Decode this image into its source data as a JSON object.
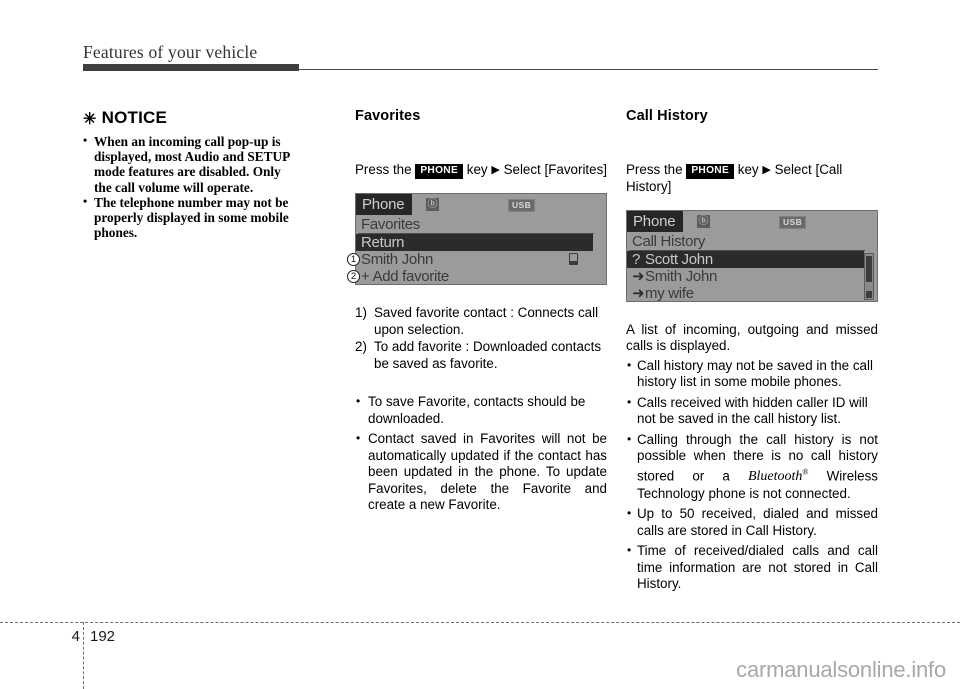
{
  "header": {
    "title": "Features of your vehicle"
  },
  "notice": {
    "title": "NOTICE",
    "asterisk": "✳",
    "items": [
      "When an incoming call pop-up is displayed, most Audio and SETUP mode features are disabled. Only the call volume will operate.",
      "The telephone number may not be properly displayed in some mobile phones."
    ],
    "item_lines": [
      [
        "When an incoming call pop-up is",
        "displayed, most Audio and SETUP",
        "mode features are disabled. Only",
        "the call volume will operate."
      ],
      [
        "The telephone number may not be",
        "properly displayed in some mobile",
        "phones."
      ]
    ]
  },
  "favorites": {
    "heading": "Favorites",
    "press": {
      "before_key": "Press the",
      "key_label": "PHONE",
      "after_key": "key",
      "arrow": "▶",
      "action": "Select [Favorites]"
    },
    "screen": {
      "statusbar": {
        "tab": "Phone",
        "bluetooth_icon": "ⓑ",
        "usb_label": "USB"
      },
      "title": "Favorites",
      "rows": [
        {
          "icon": "",
          "label": "Return",
          "selected": true,
          "handset": false
        },
        {
          "icon": "",
          "label": "Smith John",
          "selected": false,
          "handset": true
        },
        {
          "icon": "",
          "label": "+ Add favorite",
          "selected": false,
          "handset": false
        }
      ],
      "callouts": [
        "1",
        "2"
      ]
    },
    "numbered": [
      {
        "marker": "1)",
        "text": "Saved favorite contact : Connects call upon selection."
      },
      {
        "marker": "2)",
        "text": "To add favorite : Downloaded contacts be saved as favorite."
      }
    ],
    "bullets": [
      "To save Favorite, contacts should be downloaded.",
      "Contact saved in Favorites will not be automatically updated if the contact has been updated in the phone. To update Favorites, delete the Favorite and create a new Favorite."
    ]
  },
  "call_history": {
    "heading": "Call History",
    "press": {
      "before_key": "Press the",
      "key_label": "PHONE",
      "after_key": "key",
      "arrow": "▶",
      "action": "Select [Call History]"
    },
    "screen": {
      "statusbar": {
        "tab": "Phone",
        "bluetooth_icon": "ⓑ",
        "usb_label": "USB"
      },
      "title": "Call History",
      "rows": [
        {
          "icon": "?",
          "label": "Scott John",
          "selected": true
        },
        {
          "icon": "➜",
          "label": "Smith John",
          "selected": false
        },
        {
          "icon": "➜",
          "label": "my wife",
          "selected": false
        }
      ],
      "scrollbar": true
    },
    "intro": "A list of incoming, outgoing and missed calls is displayed.",
    "bullets": [
      "Call history may not be saved in the call history list in some mobile phones.",
      "Calls received with hidden caller ID will not be saved in the call history list.",
      "Up to 50 received, dialed and missed calls are stored in Call History.",
      "Time of received/dialed calls and call time information are not stored in Call History."
    ],
    "bluetooth_bullet": {
      "part1": "Calling through the call history is not possible when there is no call history stored or a",
      "brand": "Bluetooth",
      "registered": "®",
      "part2": "Wireless Technology phone is not connected."
    }
  },
  "footer": {
    "chapter": "4",
    "page": "192",
    "watermark": "carmanualsonline.info"
  }
}
